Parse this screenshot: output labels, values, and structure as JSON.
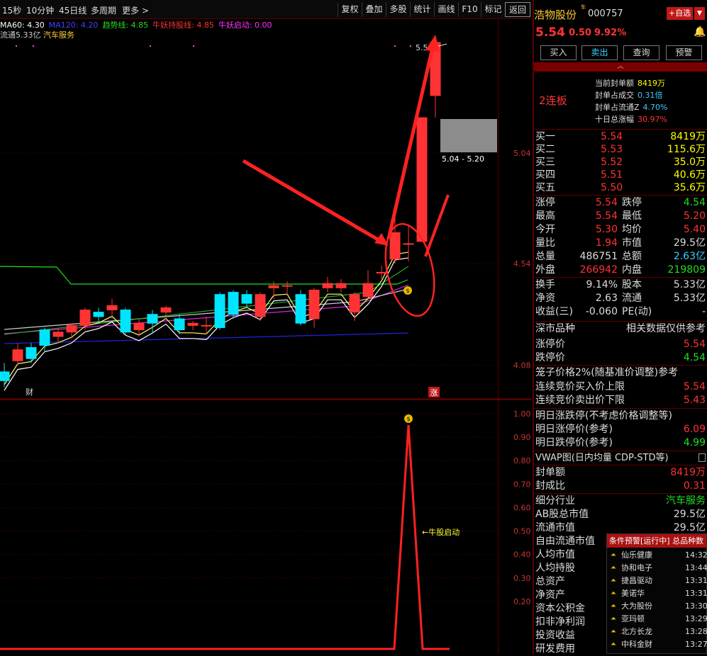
{
  "toolbar": {
    "timeframes": [
      "15秒",
      "10分钟",
      "45日线",
      "多周期",
      "更多 >"
    ],
    "buttons": [
      "复权",
      "叠加",
      "多股",
      "统计",
      "画线",
      "F10",
      "标记",
      "返回"
    ]
  },
  "indicators": [
    {
      "label": "MA60: 4.30",
      "color": "#ffffff"
    },
    {
      "label": "MA120: 4.20",
      "color": "#4040ff"
    },
    {
      "label": "趋势线: 4.85",
      "color": "#22dd22"
    },
    {
      "label": "牛妖持股线: 4.85",
      "color": "#ff3333"
    },
    {
      "label": "牛妖启动: 0.00",
      "color": "#ff33ff"
    }
  ],
  "info_line": {
    "float": "流通5.33亿",
    "sector": "汽车服务"
  },
  "chart_data": {
    "type": "candlestick",
    "price_ticks": [
      "5.04",
      "4.54",
      "4.08"
    ],
    "high_label": "5.5",
    "range_label": "5.04 - 5.20",
    "bottom_tags": [
      "财",
      "涨"
    ],
    "candles": [
      {
        "o": 4.05,
        "c": 4.01,
        "h": 4.09,
        "l": 3.98
      },
      {
        "o": 4.1,
        "c": 4.15,
        "h": 4.18,
        "l": 4.08
      },
      {
        "o": 4.16,
        "c": 4.11,
        "h": 4.18,
        "l": 4.09
      },
      {
        "o": 4.24,
        "c": 4.17,
        "h": 4.25,
        "l": 4.14
      },
      {
        "o": 4.21,
        "c": 4.23,
        "h": 4.25,
        "l": 4.18
      },
      {
        "o": 4.23,
        "c": 4.26,
        "h": 4.27,
        "l": 4.2
      },
      {
        "o": 4.26,
        "c": 4.33,
        "h": 4.34,
        "l": 4.24
      },
      {
        "o": 4.32,
        "c": 4.3,
        "h": 4.34,
        "l": 4.27
      },
      {
        "o": 4.33,
        "c": 4.35,
        "h": 4.38,
        "l": 4.29
      },
      {
        "o": 4.33,
        "c": 4.23,
        "h": 4.34,
        "l": 4.22
      },
      {
        "o": 4.24,
        "c": 4.27,
        "h": 4.29,
        "l": 4.21
      },
      {
        "o": 4.31,
        "c": 4.27,
        "h": 4.33,
        "l": 4.23
      },
      {
        "o": 4.32,
        "c": 4.34,
        "h": 4.35,
        "l": 4.3
      },
      {
        "o": 4.29,
        "c": 4.24,
        "h": 4.31,
        "l": 4.22
      },
      {
        "o": 4.26,
        "c": 4.27,
        "h": 4.28,
        "l": 4.24
      },
      {
        "o": 4.26,
        "c": 4.26,
        "h": 4.3,
        "l": 4.22
      },
      {
        "o": 4.4,
        "c": 4.25,
        "h": 4.41,
        "l": 4.24
      },
      {
        "o": 4.41,
        "c": 4.31,
        "h": 4.42,
        "l": 4.29
      },
      {
        "o": 4.4,
        "c": 4.36,
        "h": 4.42,
        "l": 4.34
      },
      {
        "o": 4.3,
        "c": 4.4,
        "h": 4.41,
        "l": 4.28
      },
      {
        "o": 4.43,
        "c": 4.44,
        "h": 4.46,
        "l": 4.38
      },
      {
        "o": 4.44,
        "c": 4.44,
        "h": 4.46,
        "l": 4.4
      },
      {
        "o": 4.4,
        "c": 4.27,
        "h": 4.42,
        "l": 4.26
      },
      {
        "o": 4.29,
        "c": 4.42,
        "h": 4.43,
        "l": 4.25
      },
      {
        "o": 4.43,
        "c": 4.45,
        "h": 4.48,
        "l": 4.41
      },
      {
        "o": 4.43,
        "c": 4.45,
        "h": 4.47,
        "l": 4.41
      },
      {
        "o": 4.32,
        "c": 4.4,
        "h": 4.41,
        "l": 4.28
      },
      {
        "o": 4.39,
        "c": 4.45,
        "h": 4.51,
        "l": 4.38
      },
      {
        "o": 4.5,
        "c": 4.5,
        "h": 4.53,
        "l": 4.47
      },
      {
        "o": 4.56,
        "c": 4.68,
        "h": 4.8,
        "l": 4.54
      },
      {
        "o": 4.63,
        "c": 4.63,
        "h": 4.71,
        "l": 4.55
      },
      {
        "o": 4.64,
        "c": 5.2,
        "h": 5.2,
        "l": 4.64
      },
      {
        "o": 5.3,
        "c": 5.54,
        "h": 5.54,
        "l": 5.2
      }
    ]
  },
  "indicator_panel": {
    "ticks": [
      "1.00",
      "0.90",
      "0.80",
      "0.70",
      "0.60",
      "0.50",
      "0.40",
      "0.30",
      "0.20"
    ],
    "label": "←牛股启动"
  },
  "stock": {
    "name": "浩物股份",
    "code": "000757",
    "add_label": "+自选",
    "price": "5.54",
    "change": "0.50",
    "pct": "9.92%",
    "actions": [
      "买入",
      "卖出",
      "查询",
      "预警"
    ],
    "streak": "2连板",
    "seal": [
      {
        "k": "当前封单额",
        "v": "8419万"
      },
      {
        "k": "封单占成交",
        "v": "0.31倍"
      },
      {
        "k": "封单占流通Z",
        "v": "4.70%"
      },
      {
        "k": "十日总涨幅",
        "v": "30.97%"
      }
    ],
    "bids": [
      {
        "k": "买一",
        "p": "5.54",
        "v": "8419万"
      },
      {
        "k": "买二",
        "p": "5.53",
        "v": "115.6万"
      },
      {
        "k": "买三",
        "p": "5.52",
        "v": "35.0万"
      },
      {
        "k": "买四",
        "p": "5.51",
        "v": "40.6万"
      },
      {
        "k": "买五",
        "p": "5.50",
        "v": "35.6万"
      }
    ],
    "stats": [
      {
        "a": "涨停",
        "av": "5.54",
        "b": "跌停",
        "bv": "4.54"
      },
      {
        "a": "最高",
        "av": "5.54",
        "b": "最低",
        "bv": "5.20"
      },
      {
        "a": "今开",
        "av": "5.30",
        "b": "均价",
        "bv": "5.40"
      },
      {
        "a": "量比",
        "av": "1.94",
        "b": "市值",
        "bv": "29.5亿"
      },
      {
        "a": "总量",
        "av": "486751",
        "b": "总额",
        "bv": "2.63亿"
      },
      {
        "a": "外盘",
        "av": "266942",
        "b": "内盘",
        "bv": "219809"
      }
    ],
    "stats2": [
      {
        "a": "换手",
        "av": "9.14%",
        "b": "股本",
        "bv": "5.33亿"
      },
      {
        "a": "净资",
        "av": "2.63",
        "b": "流通",
        "bv": "5.33亿"
      },
      {
        "a": "收益(三)",
        "av": "-0.060",
        "b": "PE(动)",
        "bv": "-"
      }
    ],
    "market": {
      "title": "深市品种",
      "note": "相关数据仅供参考"
    },
    "limit_prices": [
      {
        "k": "涨停价",
        "v": "5.54"
      },
      {
        "k": "跌停价",
        "v": "4.54"
      }
    ],
    "cage_title": "笼子价格2%(随基准价调整)参考",
    "cage": [
      {
        "k": "连续竞价买入价上限",
        "v": "5.54"
      },
      {
        "k": "连续竞价卖出价下限",
        "v": "5.43"
      }
    ],
    "tomorrow_title": "明日涨跌停(不考虑价格调整等)",
    "tomorrow": [
      {
        "k": "明日涨停价(参考)",
        "v": "6.09"
      },
      {
        "k": "明日跌停价(参考)",
        "v": "4.99"
      }
    ],
    "vwap_title": "VWAP图(日内均量 CDP-STD等)",
    "seal2": [
      {
        "k": "封单额",
        "v": "8419万"
      },
      {
        "k": "封成比",
        "v": "0.31"
      }
    ],
    "fund": [
      {
        "k": "细分行业",
        "v": "汽车服务"
      },
      {
        "k": "AB股总市值",
        "v": "29.5亿"
      },
      {
        "k": "流通市值",
        "v": "29.5亿"
      },
      {
        "k": "自由流通市值",
        "v": ""
      },
      {
        "k": "人均市值",
        "v": ""
      },
      {
        "k": "人均持股",
        "v": ""
      },
      {
        "k": "总资产",
        "v": ""
      },
      {
        "k": "净资产",
        "v": ""
      },
      {
        "k": "资本公积金",
        "v": ""
      },
      {
        "k": "扣非净利润",
        "v": ""
      },
      {
        "k": "投资收益",
        "v": ""
      },
      {
        "k": "研发费用",
        "v": ""
      }
    ]
  },
  "alert": {
    "title": "条件预警[运行中] 总品种数",
    "items": [
      {
        "name": "仙乐健康",
        "time": "14:32"
      },
      {
        "name": "协和电子",
        "time": "13:44"
      },
      {
        "name": "捷昌驱动",
        "time": "13:31"
      },
      {
        "name": "美诺华",
        "time": "13:31"
      },
      {
        "name": "大为股份",
        "time": "13:30"
      },
      {
        "name": "亚玛顿",
        "time": "13:29"
      },
      {
        "name": "北方长龙",
        "time": "13:28"
      },
      {
        "name": "中科金财",
        "time": "13:27"
      }
    ]
  },
  "colors": {
    "up": "#ff3333",
    "down": "#00e5ff",
    "accent": "#ff2222",
    "yellow": "#ffff00",
    "grid": "#5a0000"
  }
}
